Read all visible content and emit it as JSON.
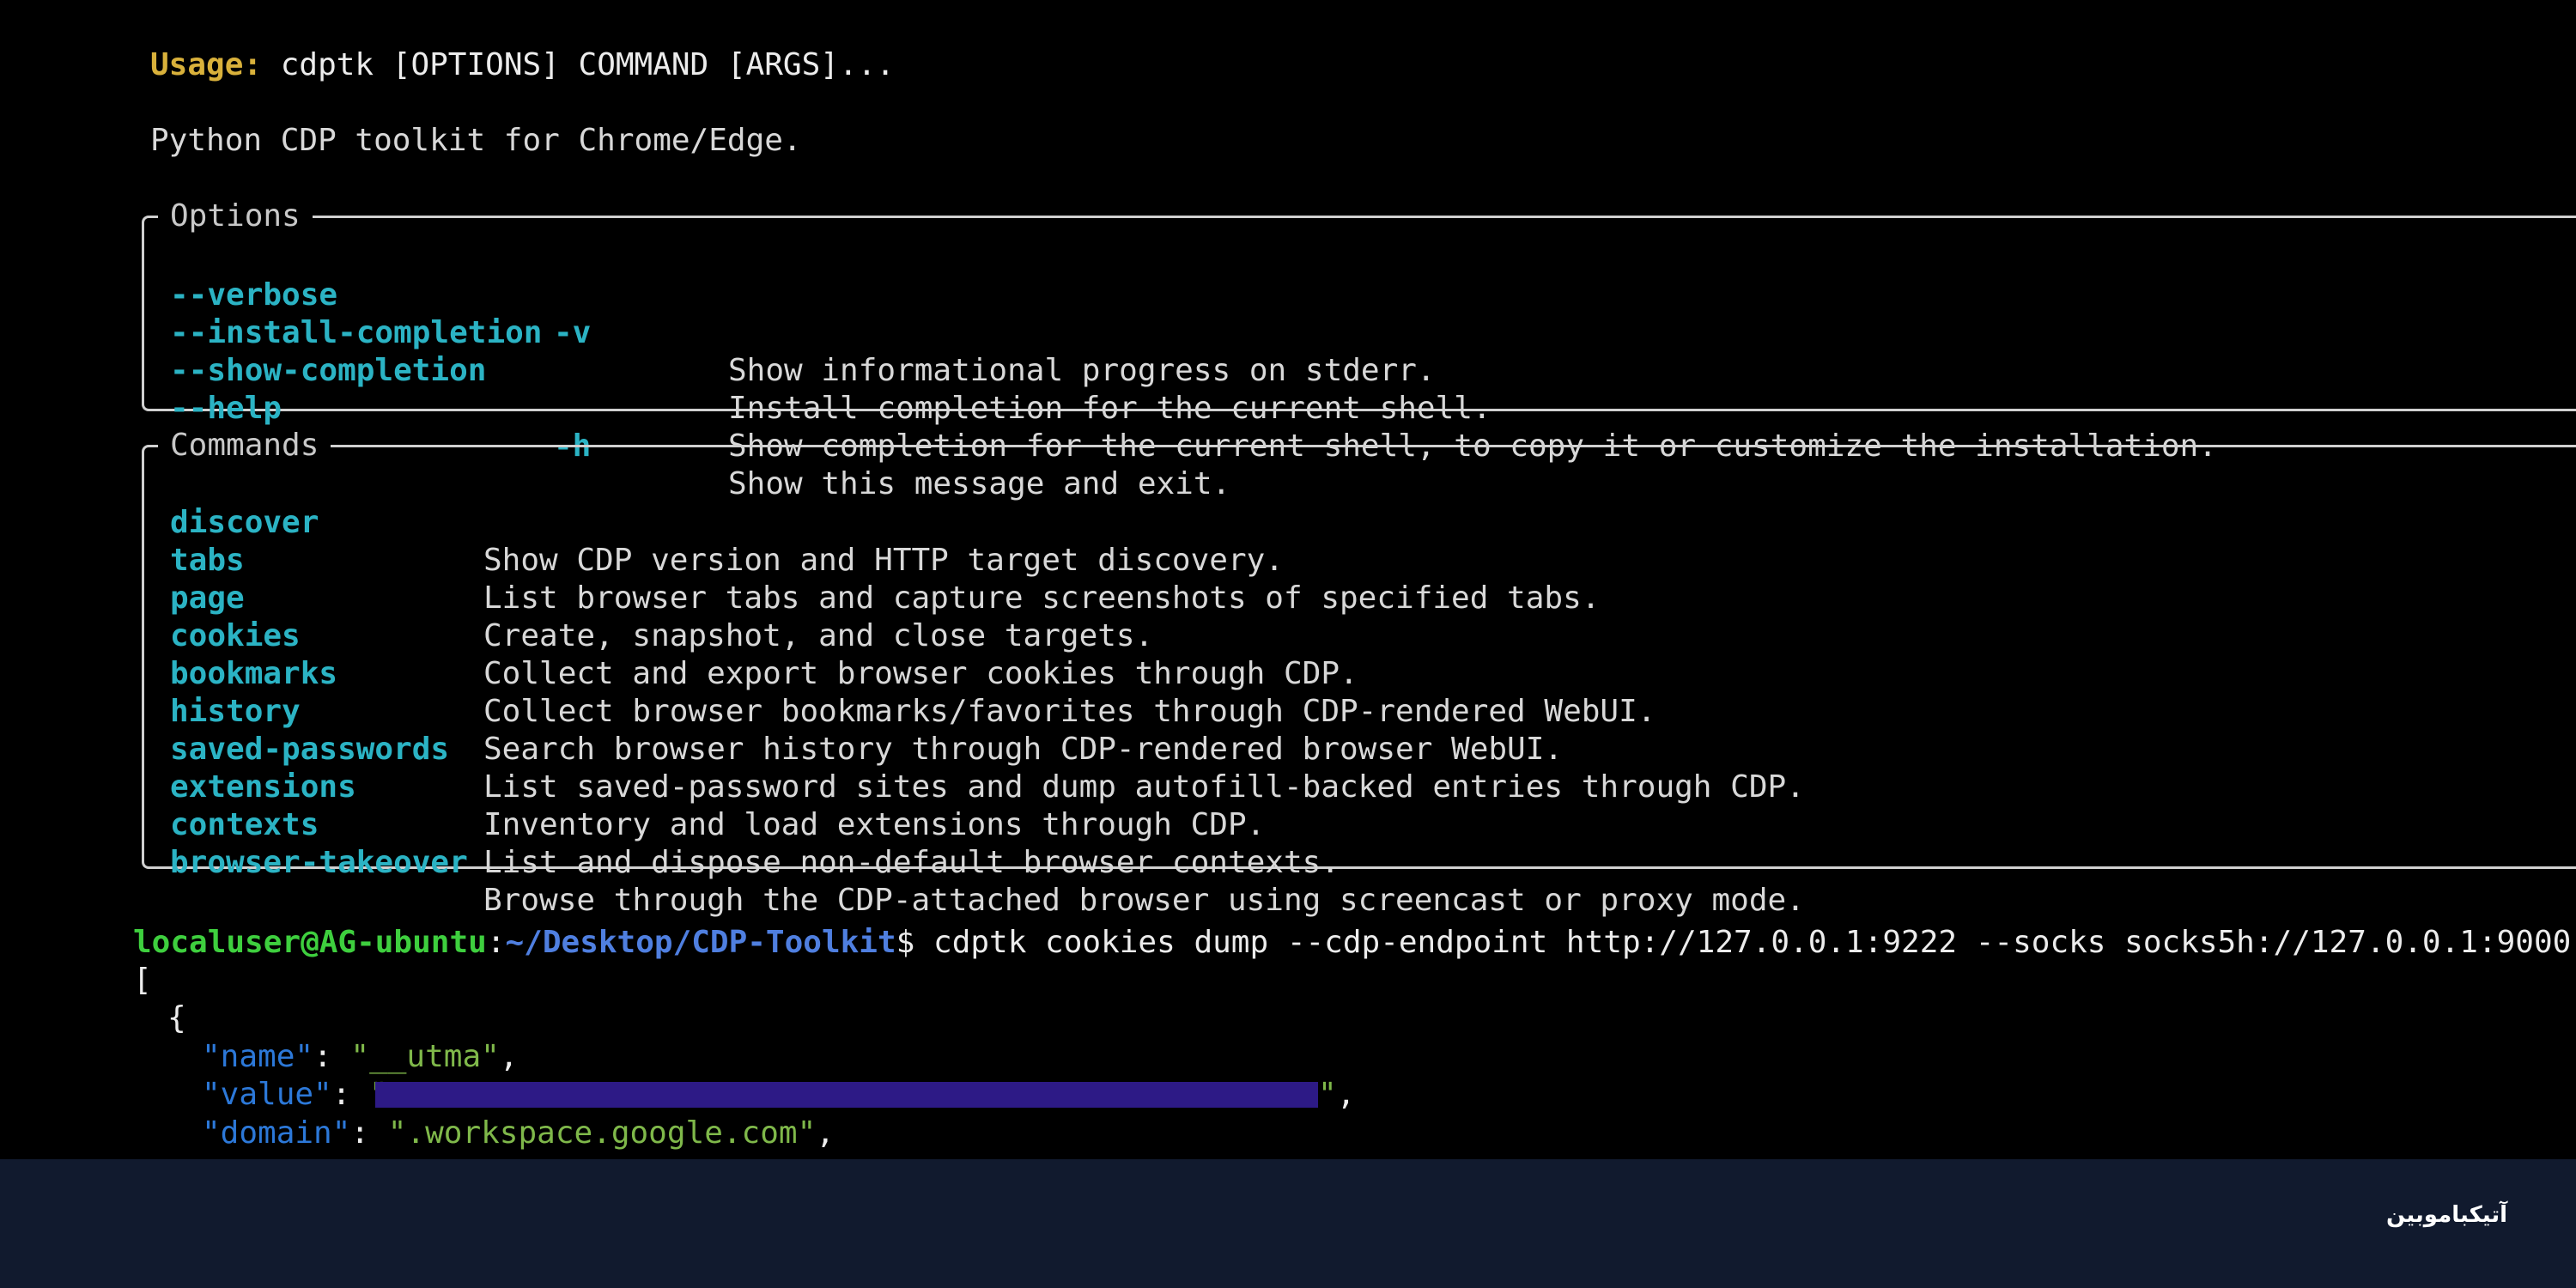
{
  "usage": {
    "label": "Usage:",
    "text": "cdptk [OPTIONS] COMMAND [ARGS]..."
  },
  "description": "Python CDP toolkit for Chrome/Edge.",
  "options": {
    "title": "Options",
    "items": [
      {
        "flag": "--verbose",
        "short": "-v",
        "desc": "Show informational progress on stderr."
      },
      {
        "flag": "--install-completion",
        "short": "",
        "desc": "Install completion for the current shell."
      },
      {
        "flag": "--show-completion",
        "short": "",
        "desc": "Show completion for the current shell, to copy it or customize the installation."
      },
      {
        "flag": "--help",
        "short": "-h",
        "desc": "Show this message and exit."
      }
    ]
  },
  "commands": {
    "title": "Commands",
    "items": [
      {
        "name": "discover",
        "desc": "Show CDP version and HTTP target discovery."
      },
      {
        "name": "tabs",
        "desc": "List browser tabs and capture screenshots of specified tabs."
      },
      {
        "name": "page",
        "desc": "Create, snapshot, and close targets."
      },
      {
        "name": "cookies",
        "desc": "Collect and export browser cookies through CDP."
      },
      {
        "name": "bookmarks",
        "desc": "Collect browser bookmarks/favorites through CDP-rendered WebUI."
      },
      {
        "name": "history",
        "desc": "Search browser history through CDP-rendered browser WebUI."
      },
      {
        "name": "saved-passwords",
        "desc": "List saved-password sites and dump autofill-backed entries through CDP."
      },
      {
        "name": "extensions",
        "desc": "Inventory and load extensions through CDP."
      },
      {
        "name": "contexts",
        "desc": "List and dispose non-default browser contexts."
      },
      {
        "name": "browser-takeover",
        "desc": "Browse through the CDP-attached browser using screencast or proxy mode."
      }
    ]
  },
  "prompt": {
    "user_host": "localuser@AG-ubuntu",
    "separator": ":",
    "path": "~/Desktop/CDP-Toolkit",
    "dollar": "$",
    "command": " cdptk cookies dump --cdp-endpoint http://127.0.0.1:9222 --socks socks5h://127.0.0.1:9000"
  },
  "json_output": {
    "open_bracket": "[",
    "open_brace": "{",
    "name_key": "\"name\"",
    "name_value": "\"__utma\"",
    "value_key": "\"value\"",
    "value_open": "\"",
    "value_close": "\"",
    "domain_key": "\"domain\"",
    "domain_value": "\".workspace.google.com\"",
    "colon": ": ",
    "comma": ","
  },
  "footer": {
    "brand": "آتیکباموبین"
  },
  "colors": {
    "background": "#000000",
    "footer_bg": "#111a2e",
    "usage_label": "#d9b13b",
    "option_flag": "#2bb3c4",
    "prompt_user": "#3ecf3e",
    "prompt_path": "#4f7fe0",
    "json_string": "#7fb84a",
    "json_key": "#2c78d8",
    "redaction": "#2d1a86"
  }
}
